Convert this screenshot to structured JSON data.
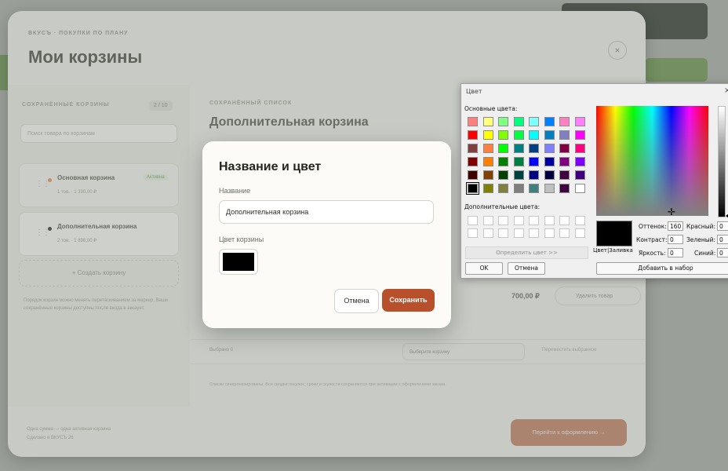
{
  "modal": {
    "breadcrumb": "ВКУСЪ · ПОКУПКИ ПО ПЛАНУ",
    "title": "Мои корзины",
    "close_glyph": "×",
    "sidebar": {
      "section_label": "СОХРАНЁННЫЕ КОРЗИНЫ",
      "count": "2 / 10",
      "search_placeholder": "Поиск товара по корзинам",
      "items": [
        {
          "name": "Основная корзина",
          "meta": "1 тов. · 1 330,00 ₽",
          "tag": "Активна",
          "dot_color": "#e07a3a"
        },
        {
          "name": "Дополнительная корзина",
          "meta": "2 тов. · 1 898,00 ₽",
          "tag": "",
          "dot_color": "#111111"
        }
      ],
      "create_label": "+ Создать корзину",
      "note": "Порядок корзин можно менять перетаскиванием за маркер. Ваши сохранённые корзины доступны после входа в аккаунт."
    },
    "main": {
      "section_label": "СОХРАНЁННЫЙ СПИСОК",
      "title": "Дополнительная корзина",
      "price": "700,00 ₽",
      "delete_label": "Удалить товар",
      "selected_label": "Выбрано 0",
      "select_placeholder": "Выберите корзину",
      "move_label": "Переместить выбранное",
      "footnote": "Списки синхронизированы. Все сводки покупок, сроки и скупости сохраняются при активации с оформлением заказа."
    },
    "footer": {
      "line1": "Одна сумма — одна активная корзина",
      "line2": "Сделано в ВКУСЪ 26"
    },
    "checkout_label": "Перейти к оформлению →"
  },
  "dialog": {
    "title": "Название и цвет",
    "name_label": "Название",
    "name_value": "Дополнительная корзина",
    "color_label": "Цвет корзины",
    "color_value": "#000000",
    "cancel_label": "Отмена",
    "save_label": "Сохранить"
  },
  "color_picker": {
    "title": "Цвет",
    "close_glyph": "×",
    "basic_colors_label": "Основные цвета:",
    "basic_colors": [
      "#ff8080",
      "#ffff80",
      "#80ff80",
      "#00ff80",
      "#80ffff",
      "#0080ff",
      "#ff80c0",
      "#ff80ff",
      "#ff0000",
      "#ffff00",
      "#80ff00",
      "#00ff40",
      "#00ffff",
      "#0080c0",
      "#8080c0",
      "#ff00ff",
      "#804040",
      "#ff8040",
      "#00ff00",
      "#008080",
      "#004080",
      "#8080ff",
      "#800040",
      "#ff0080",
      "#800000",
      "#ff8000",
      "#008000",
      "#008040",
      "#0000ff",
      "#0000a0",
      "#800080",
      "#8000ff",
      "#400000",
      "#804000",
      "#004000",
      "#004040",
      "#000080",
      "#000040",
      "#400040",
      "#400080",
      "#000000",
      "#808000",
      "#808040",
      "#808080",
      "#408080",
      "#c0c0c0",
      "#400040",
      "#ffffff"
    ],
    "selected_index": 40,
    "custom_colors_label": "Дополнительные цвета:",
    "define_label": "Определить цвет >>",
    "ok_label": "OK",
    "cancel_label": "Отмена",
    "preview_label": "Цвет|Заливка",
    "add_label": "Добавить в набор",
    "hue_label": "Оттенок:",
    "hue": "160",
    "sat_label": "Контраст:",
    "sat": "0",
    "lum_label": "Яркость:",
    "lum": "0",
    "red_label": "Красный:",
    "red": "0",
    "green_label": "Зеленый:",
    "green": "0",
    "blue_label": "Синий:",
    "blue": "0"
  }
}
